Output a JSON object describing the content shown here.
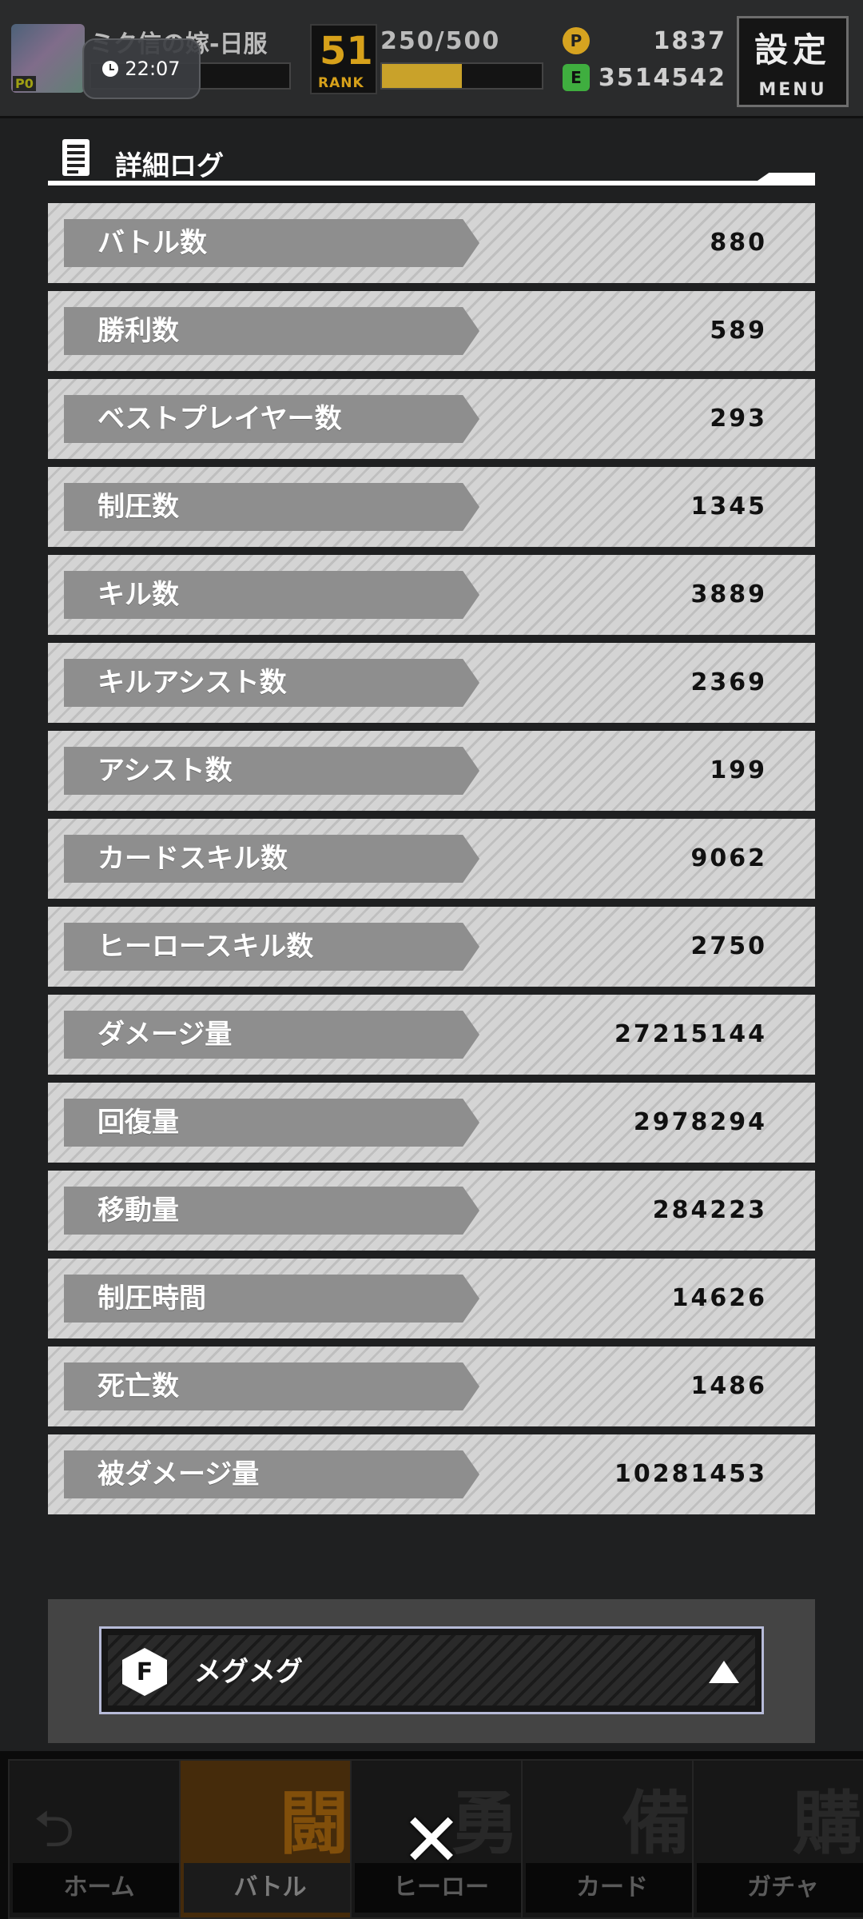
{
  "status": {
    "player_name": "ミク信の嫁-日服",
    "player_badge": "P0",
    "clock": "22:07",
    "rank_number": "51",
    "rank_label": "RANK",
    "stamina": "250/500",
    "stamina_level": 0.5,
    "coin_gold_symbol": "P",
    "coin_gold_value": "1837",
    "coin_green_symbol": "E",
    "coin_green_value": "3514542",
    "menu_kanji": "設定",
    "menu_label": "MENU"
  },
  "panel": {
    "title": "詳細ログ",
    "stats": [
      {
        "label": "バトル数",
        "value": "880"
      },
      {
        "label": "勝利数",
        "value": "589"
      },
      {
        "label": "ベストプレイヤー数",
        "value": "293"
      },
      {
        "label": "制圧数",
        "value": "1345"
      },
      {
        "label": "キル数",
        "value": "3889"
      },
      {
        "label": "キルアシスト数",
        "value": "2369"
      },
      {
        "label": "アシスト数",
        "value": "199"
      },
      {
        "label": "カードスキル数",
        "value": "9062"
      },
      {
        "label": "ヒーロースキル数",
        "value": "2750"
      },
      {
        "label": "ダメージ量",
        "value": "27215144"
      },
      {
        "label": "回復量",
        "value": "2978294"
      },
      {
        "label": "移動量",
        "value": "284223"
      },
      {
        "label": "制圧時間",
        "value": "14626"
      },
      {
        "label": "死亡数",
        "value": "1486"
      },
      {
        "label": "被ダメージ量",
        "value": "10281453"
      }
    ]
  },
  "hero_selector": {
    "icon_letter": "F",
    "name": "メグメグ",
    "arrow_icon": "triangle-up-icon"
  },
  "bottom_nav": [
    {
      "kanji": "",
      "glyph": "⮌",
      "label": "ホーム"
    },
    {
      "kanji": "闘",
      "glyph": "",
      "label": "バトル"
    },
    {
      "kanji": "勇",
      "glyph": "",
      "label": "ヒーロー"
    },
    {
      "kanji": "備",
      "glyph": "",
      "label": "カード"
    },
    {
      "kanji": "購",
      "glyph": "",
      "label": "ガチャ"
    }
  ],
  "close_glyph": "✕",
  "colors": {
    "accent_gold": "#c9a22a",
    "nav_active": "#c77a12"
  }
}
